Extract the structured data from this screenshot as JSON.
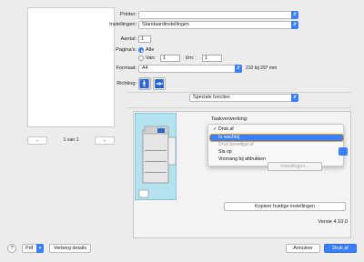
{
  "printer": {
    "label": "Printer:",
    "value": ""
  },
  "presets": {
    "label": "Instellingen:",
    "value": "Standaardinstellingen"
  },
  "copies": {
    "label": "Aantal:",
    "value": "1"
  },
  "pages": {
    "label": "Pagina's:",
    "all_label": "Alle",
    "from_label": "Van:",
    "from_value": "1",
    "to_label": "t/m:",
    "to_value": "1"
  },
  "paper_size": {
    "label": "Formaat:",
    "value": "A4",
    "dims": "210 bij 297 mm"
  },
  "orientation": {
    "label": "Richting:"
  },
  "section_popup": {
    "value": "Speciale functies"
  },
  "preview": {
    "pager_text": "1 van 1"
  },
  "job_processing": {
    "label": "Taakverwerking:",
    "menu": [
      {
        "label": "Druk af",
        "checked": true
      },
      {
        "label": "In wachtrij",
        "highlighted": true
      },
      {
        "label": "Druk beveiligd af",
        "dimmed": true
      },
      {
        "label": "Sla op"
      },
      {
        "label": "Voorrang bij afdrukken"
      }
    ],
    "settings_button": "Instellingen..."
  },
  "copy_button": "Kopieer huidige instellingen",
  "version": "Versie 4.10.0",
  "footer": {
    "help": "?",
    "pdf": "Pdf",
    "hide_details": "Verberg details",
    "cancel": "Annuleer",
    "print": "Druk af"
  },
  "colors": {
    "accent": "#3b7ff6",
    "highlight_outline": "#f29b1f",
    "printer_bg": "#b4e2ee"
  }
}
